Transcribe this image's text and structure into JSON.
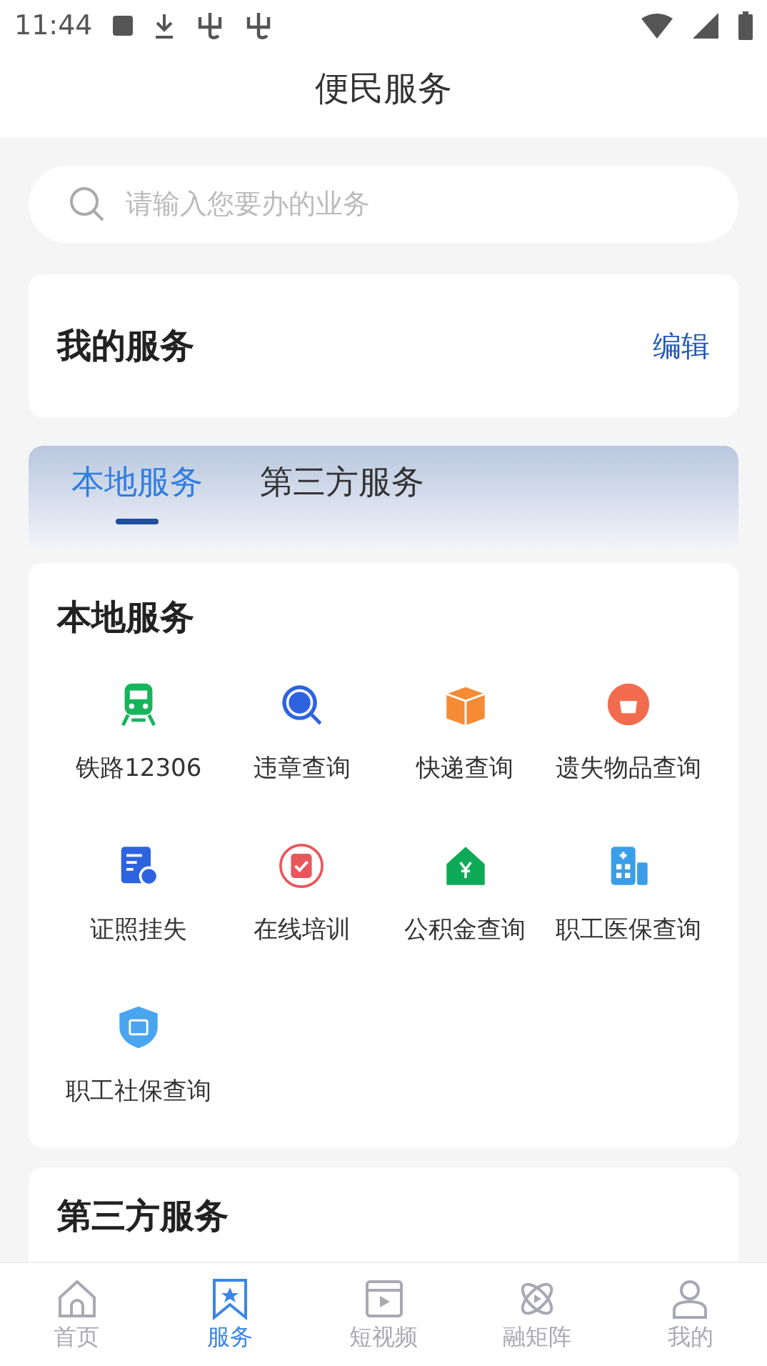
{
  "status_bar": {
    "time": "11:44"
  },
  "header": {
    "title": "便民服务"
  },
  "search": {
    "placeholder": "请输入您要办的业务"
  },
  "my_services": {
    "title": "我的服务",
    "action": "编辑"
  },
  "tabs": [
    {
      "label": "本地服务",
      "selected": true
    },
    {
      "label": "第三方服务",
      "selected": false
    }
  ],
  "local_services": {
    "title": "本地服务",
    "items": [
      {
        "label": "铁路12306"
      },
      {
        "label": "违章查询"
      },
      {
        "label": "快递查询"
      },
      {
        "label": "遗失物品查询"
      },
      {
        "label": "证照挂失"
      },
      {
        "label": "在线培训"
      },
      {
        "label": "公积金查询"
      },
      {
        "label": "职工医保查询"
      },
      {
        "label": "职工社保查询"
      }
    ]
  },
  "third_party_services": {
    "title": "第三方服务"
  },
  "bottom_nav": [
    {
      "label": "首页",
      "selected": false
    },
    {
      "label": "服务",
      "selected": true
    },
    {
      "label": "短视频",
      "selected": false
    },
    {
      "label": "融矩阵",
      "selected": false
    },
    {
      "label": "我的",
      "selected": false
    }
  ]
}
